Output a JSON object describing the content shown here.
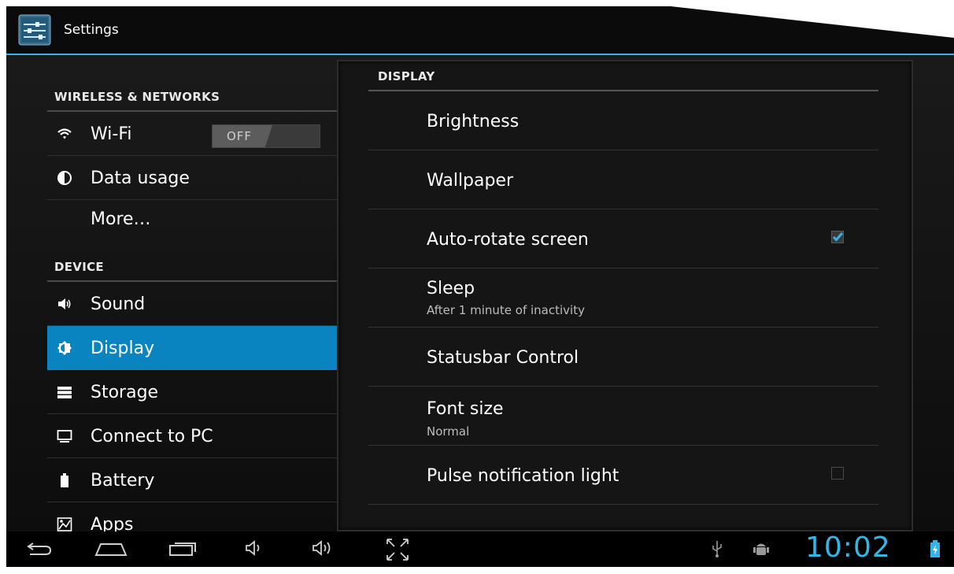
{
  "app": {
    "title": "Settings"
  },
  "sidebar": {
    "headers": {
      "wireless": "WIRELESS & NETWORKS",
      "device": "DEVICE"
    },
    "items": [
      {
        "label": "Wi-Fi",
        "icon": "wifi-icon"
      },
      {
        "label": "Data usage",
        "icon": "data-usage-icon"
      },
      {
        "label": "More…",
        "icon": ""
      },
      {
        "label": "Sound",
        "icon": "speaker-icon"
      },
      {
        "label": "Display",
        "icon": "brightness-icon",
        "selected": true
      },
      {
        "label": "Storage",
        "icon": "storage-icon"
      },
      {
        "label": "Connect to PC",
        "icon": "monitor-icon"
      },
      {
        "label": "Battery",
        "icon": "battery-icon"
      },
      {
        "label": "Apps",
        "icon": "apps-icon"
      }
    ],
    "wifi_toggle": "OFF"
  },
  "display": {
    "header": "DISPLAY",
    "items": [
      {
        "title": "Brightness"
      },
      {
        "title": "Wallpaper"
      },
      {
        "title": "Auto-rotate screen",
        "checked": true
      },
      {
        "title": "Sleep",
        "summary": "After 1 minute of inactivity"
      },
      {
        "title": "Statusbar Control"
      },
      {
        "title": "Font size",
        "summary": "Normal"
      },
      {
        "title": "Pulse notification light",
        "checked": false
      }
    ]
  },
  "statusbar": {
    "time": "10:02"
  },
  "colors": {
    "accent": "#33b5e5",
    "selected": "#0a84c0"
  }
}
